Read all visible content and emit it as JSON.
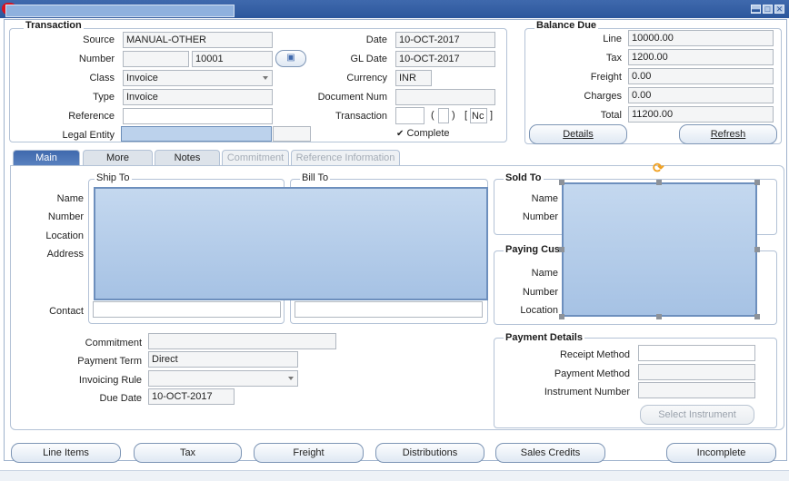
{
  "window": {
    "minimize_icon": "minimize-icon",
    "maximize_icon": "maximize-icon",
    "close_icon": "close-icon"
  },
  "transaction": {
    "title": "Transaction",
    "source": {
      "label": "Source",
      "value": "MANUAL-OTHER"
    },
    "number": {
      "label": "Number",
      "value": "10001"
    },
    "class": {
      "label": "Class",
      "value": "Invoice"
    },
    "type": {
      "label": "Type",
      "value": "Invoice"
    },
    "reference": {
      "label": "Reference",
      "value": ""
    },
    "legal_entity": {
      "label": "Legal Entity",
      "value": ""
    },
    "date": {
      "label": "Date",
      "value": "10-OCT-2017"
    },
    "gl_date": {
      "label": "GL Date",
      "value": "10-OCT-2017"
    },
    "currency": {
      "label": "Currency",
      "value": "INR"
    },
    "document_num": {
      "label": "Document Num",
      "value": ""
    },
    "transaction": {
      "label": "Transaction",
      "paren_open": "(",
      "paren_close": ")",
      "bracket_open": "[",
      "bracket_value": "Nc",
      "bracket_close": "]"
    },
    "complete": {
      "label": "Complete",
      "checked": true
    }
  },
  "balance_due": {
    "title": "Balance Due",
    "line": {
      "label": "Line",
      "value": "10000.00"
    },
    "tax": {
      "label": "Tax",
      "value": "1200.00"
    },
    "freight": {
      "label": "Freight",
      "value": "0.00"
    },
    "charges": {
      "label": "Charges",
      "value": "0.00"
    },
    "total": {
      "label": "Total",
      "value": "11200.00"
    },
    "details_button": "Details",
    "refresh_button": "Refresh"
  },
  "tabs": [
    {
      "label": "Main",
      "state": "active"
    },
    {
      "label": "More",
      "state": "normal"
    },
    {
      "label": "Notes",
      "state": "normal"
    },
    {
      "label": "Commitment",
      "state": "disabled"
    },
    {
      "label": "Reference Information",
      "state": "disabled"
    }
  ],
  "main": {
    "ship_to": "Ship To",
    "bill_to": "Bill To",
    "name_label": "Name",
    "number_label": "Number",
    "location_label": "Location",
    "address_label": "Address",
    "contact_label": "Contact",
    "sold_to": {
      "title": "Sold To",
      "name_label": "Name",
      "number_label": "Number"
    },
    "paying_customer": {
      "title": "Paying Cus",
      "name_label": "Name",
      "number_label": "Number",
      "location_label": "Location"
    },
    "commitment": {
      "label": "Commitment",
      "value": ""
    },
    "payment_term": {
      "label": "Payment Term",
      "value": "Direct"
    },
    "invoicing_rule": {
      "label": "Invoicing Rule",
      "value": ""
    },
    "due_date": {
      "label": "Due Date",
      "value": "10-OCT-2017"
    },
    "payment_details": {
      "title": "Payment Details",
      "receipt_method": {
        "label": "Receipt Method",
        "value": ""
      },
      "payment_method": {
        "label": "Payment Method",
        "value": ""
      },
      "instrument_number": {
        "label": "Instrument Number",
        "value": ""
      },
      "select_instrument_button": "Select Instrument"
    }
  },
  "bottom_buttons": [
    "Line Items",
    "Tax",
    "Freight",
    "Distributions",
    "Sales Credits",
    "Incomplete"
  ]
}
